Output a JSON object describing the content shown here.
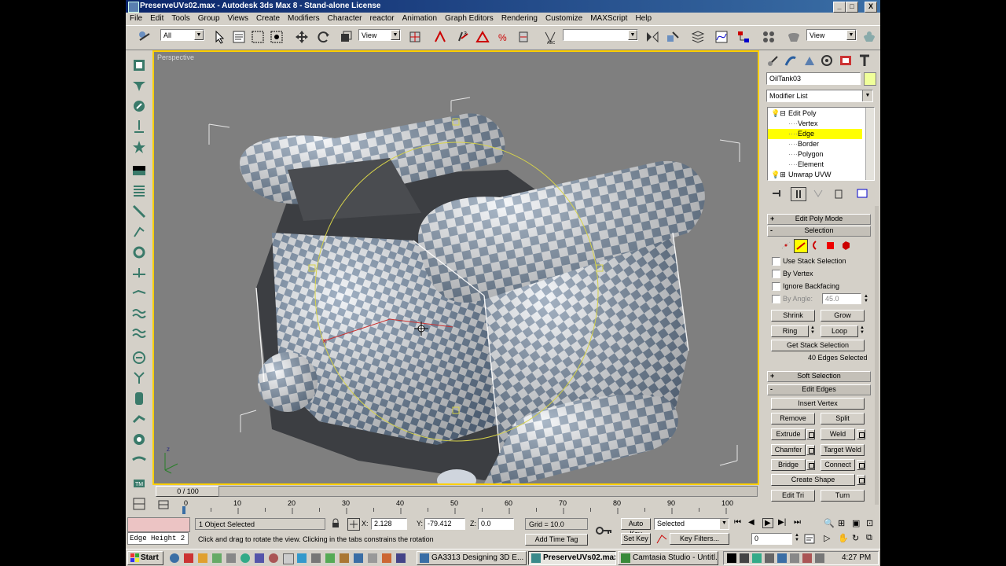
{
  "window": {
    "title": "PreserveUVs02.max - Autodesk 3ds Max 8  - Stand-alone License",
    "controls": [
      "_",
      "□",
      "X"
    ]
  },
  "menu": [
    "File",
    "Edit",
    "Tools",
    "Group",
    "Views",
    "Create",
    "Modifiers",
    "Character",
    "reactor",
    "Animation",
    "Graph Editors",
    "Rendering",
    "Customize",
    "MAXScript",
    "Help"
  ],
  "toolbar": {
    "selection_filter": "All",
    "ref_coord": "View",
    "named_sets": "",
    "ref_coord2": "View"
  },
  "viewport": {
    "label": "Perspective"
  },
  "command_panel": {
    "object_name": "OilTank03",
    "object_color": "#f0ff9a",
    "modifier_list": "Modifier List",
    "stack": [
      {
        "label": "Edit Poly",
        "level": 0
      },
      {
        "label": "Vertex",
        "level": 1
      },
      {
        "label": "Edge",
        "level": 1,
        "selected": true
      },
      {
        "label": "Border",
        "level": 1
      },
      {
        "label": "Polygon",
        "level": 1
      },
      {
        "label": "Element",
        "level": 1
      },
      {
        "label": "Unwrap UVW",
        "level": 0
      }
    ],
    "rollouts": {
      "edit_poly_mode": "Edit Poly Mode",
      "selection": "Selection",
      "use_stack_selection": "Use Stack Selection",
      "by_vertex": "By Vertex",
      "ignore_backfacing": "Ignore Backfacing",
      "by_angle": "By Angle:",
      "by_angle_value": "45.0",
      "shrink": "Shrink",
      "grow": "Grow",
      "ring": "Ring",
      "loop": "Loop",
      "get_stack_selection": "Get Stack Selection",
      "selected_count": "40 Edges Selected",
      "soft_selection": "Soft Selection",
      "edit_edges": "Edit Edges",
      "insert_vertex": "Insert Vertex",
      "remove": "Remove",
      "split": "Split",
      "extrude": "Extrude",
      "weld": "Weld",
      "chamfer": "Chamfer",
      "target_weld": "Target Weld",
      "bridge": "Bridge",
      "connect": "Connect",
      "create_shape": "Create Shape",
      "edit_tri": "Edit Tri",
      "turn": "Turn"
    }
  },
  "timeline": {
    "slider": "0 / 100",
    "ticks": [
      "0",
      "10",
      "20",
      "30",
      "40",
      "50",
      "60",
      "70",
      "80",
      "90",
      "100"
    ]
  },
  "status": {
    "script_listener": "Edge Height 2",
    "selection_info": "1 Object Selected",
    "prompt": "Click and drag to rotate the view.  Clicking in the tabs constrains the rotation",
    "x_label": "X:",
    "x_value": "2.128",
    "y_label": "Y:",
    "y_value": "-79.412",
    "z_label": "Z:",
    "z_value": "0.0",
    "grid": "Grid = 10.0",
    "add_time_tag": "Add Time Tag",
    "auto_key": "Auto Key",
    "set_key": "Set Key",
    "key_mode": "Selected",
    "key_filters": "Key Filters...",
    "frame": "0"
  },
  "taskbar": {
    "start": "Start",
    "tasks": [
      {
        "label": "GA3313 Designing 3D E...",
        "active": false
      },
      {
        "label": "PreserveUVs02.max ...",
        "active": true
      },
      {
        "label": "Camtasia Studio - Untitl...",
        "active": false
      }
    ],
    "clock": "4:27 PM"
  }
}
